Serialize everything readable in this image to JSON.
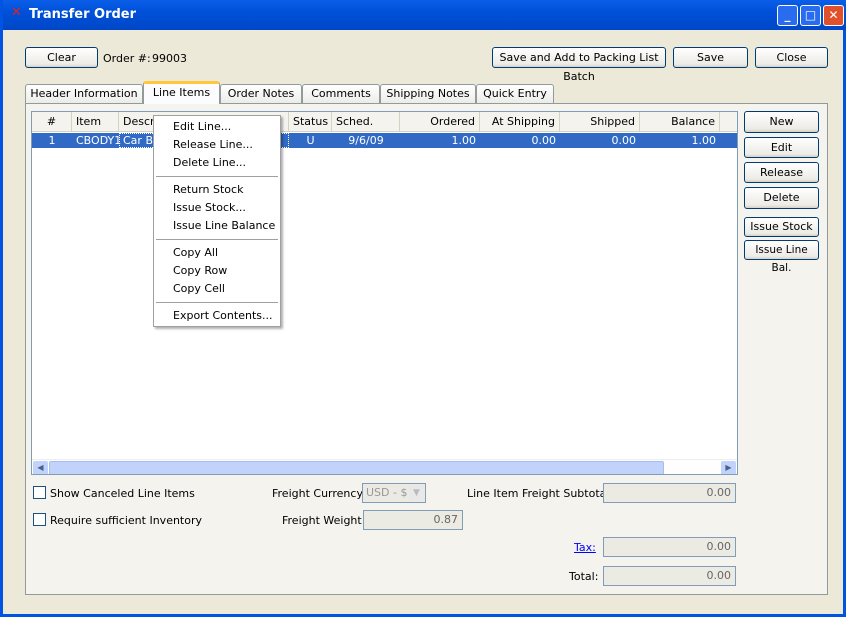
{
  "window": {
    "title": "Transfer Order"
  },
  "toolbar": {
    "clear": "Clear",
    "order_label": "Order #:",
    "order_number": "99003",
    "save_add": "Save and Add to Packing List Batch",
    "save": "Save",
    "close": "Close"
  },
  "tabs": [
    "Header Information",
    "Line Items",
    "Order Notes",
    "Comments",
    "Shipping Notes",
    "Quick Entry"
  ],
  "table": {
    "columns": [
      "#",
      "Item",
      "Descrip",
      "Status",
      "Sched. Date",
      "Ordered",
      "At Shipping",
      "Shipped",
      "Balance"
    ],
    "rows": [
      {
        "num": "1",
        "item": "CBODY1",
        "desc": "Car Bo",
        "status": "U",
        "sched": "9/6/09",
        "ordered": "1.00",
        "at_shipping": "0.00",
        "shipped": "0.00",
        "balance": "1.00"
      }
    ]
  },
  "side_buttons": [
    "New",
    "Edit",
    "Release",
    "Delete",
    "Issue Stock",
    "Issue Line Bal."
  ],
  "context_menu": [
    "Edit Line...",
    "Release Line...",
    "Delete Line...",
    "Return Stock",
    "Issue Stock...",
    "Issue Line Balance",
    "Copy All",
    "Copy Row",
    "Copy Cell",
    "Export Contents..."
  ],
  "footer": {
    "show_canceled": "Show Canceled Line Items",
    "require_inventory": "Require sufficient Inventory",
    "freight_currency_label": "Freight Currency:",
    "freight_currency": "USD - $",
    "freight_weight_label": "Freight Weight:",
    "freight_weight": "0.87",
    "subtotal_label": "Line Item Freight Subtotal:",
    "subtotal": "0.00",
    "tax_label": "Tax:",
    "tax": "0.00",
    "total_label": "Total:",
    "total": "0.00"
  }
}
